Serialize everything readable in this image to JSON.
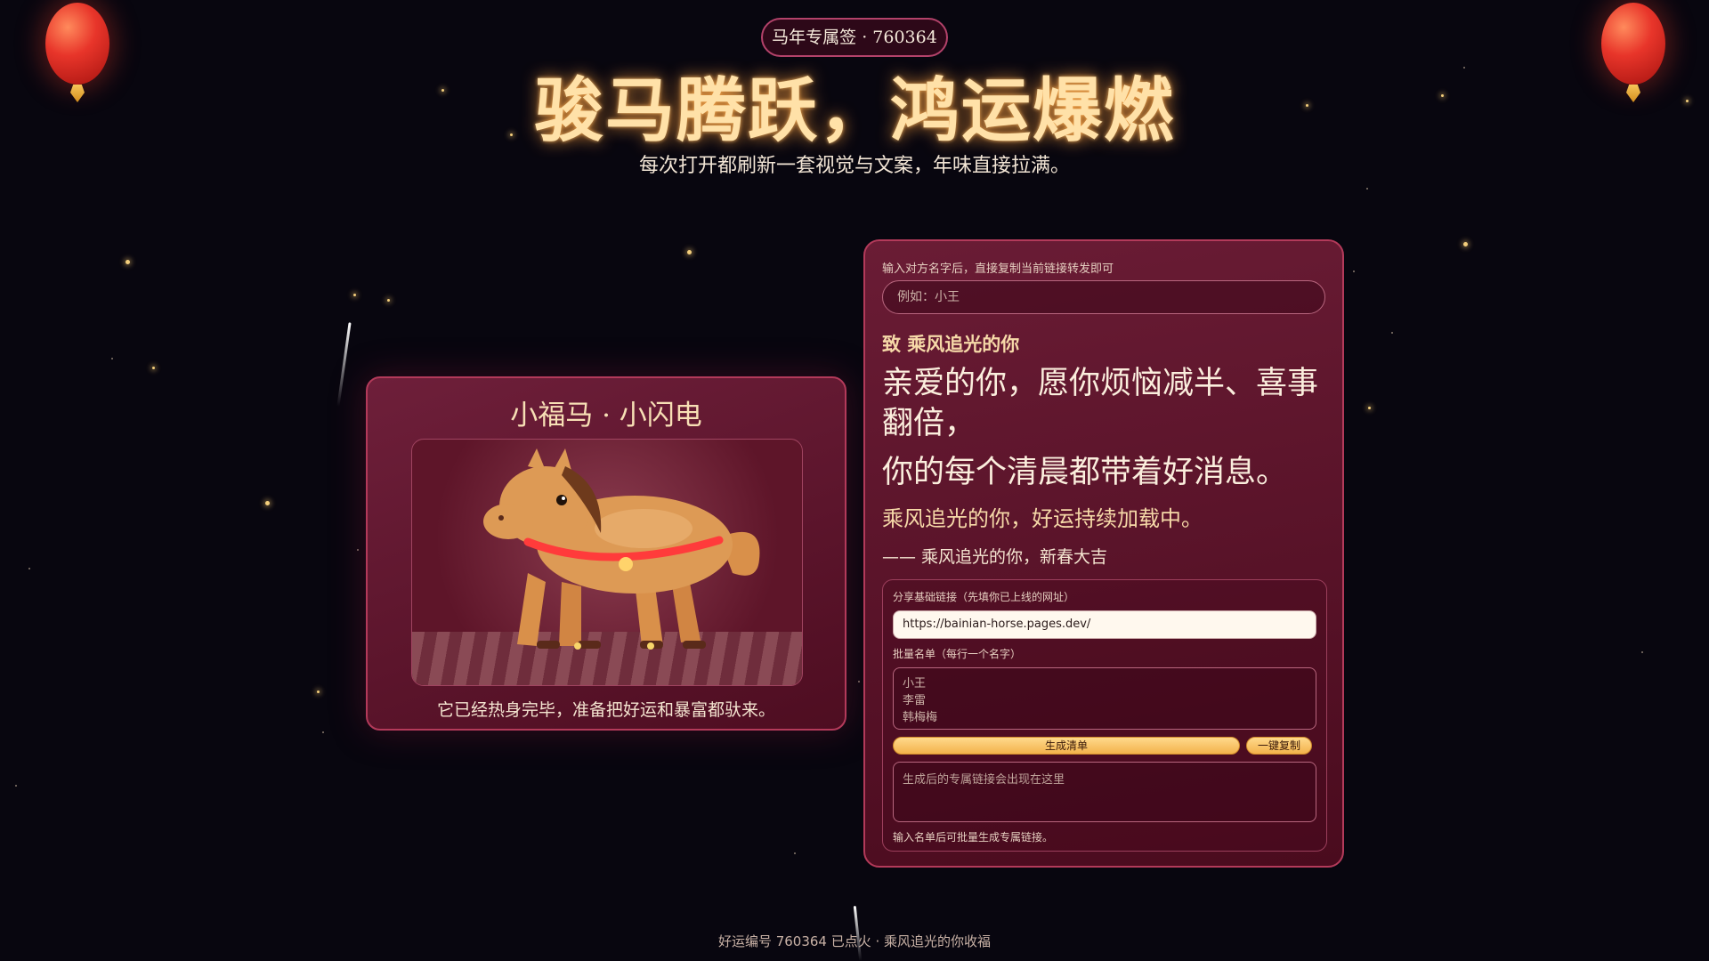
{
  "badge": "马年专属签 · 760364",
  "title": "骏马腾跃，鸿运爆燃",
  "subtitle": "每次打开都刷新一套视觉与文案，年味直接拉满。",
  "horse_card": {
    "title": "小福马 · 小闪电",
    "caption": "它已经热身完毕，准备把好运和暴富都驮来。"
  },
  "blessing_panel": {
    "hint": "输入对方名字后，直接复制当前链接转发即可",
    "name_placeholder": "例如：小王",
    "to_line": "致 乘风追光的你",
    "message_line1": "亲爱的你，愿你烦恼减半、喜事翻倍，",
    "message_line2": "你的每个清晨都带着好消息。",
    "message_line3": "乘风追光的你，好运持续加载中。",
    "signature": "—— 乘风追光的你，新春大吉"
  },
  "batch": {
    "base_url_label": "分享基础链接（先填你已上线的网址）",
    "base_url_value": "https://bainian-horse.pages.dev/",
    "names_label": "批量名单（每行一个名字）",
    "names_placeholder": [
      "小王",
      "李雷",
      "韩梅梅"
    ],
    "generate_button": "生成清单",
    "copy_button": "一键复制",
    "output_placeholder": "生成后的专属链接会出现在这里",
    "status": "输入名单后可批量生成专属链接。"
  },
  "footer": "好运编号 760364 已点火 · 乘风追光的你收福",
  "colors": {
    "background": "#08060f",
    "accent_gold": "#ffe1a8",
    "card_border": "#b33a5a",
    "lantern_red": "#e8352a"
  }
}
